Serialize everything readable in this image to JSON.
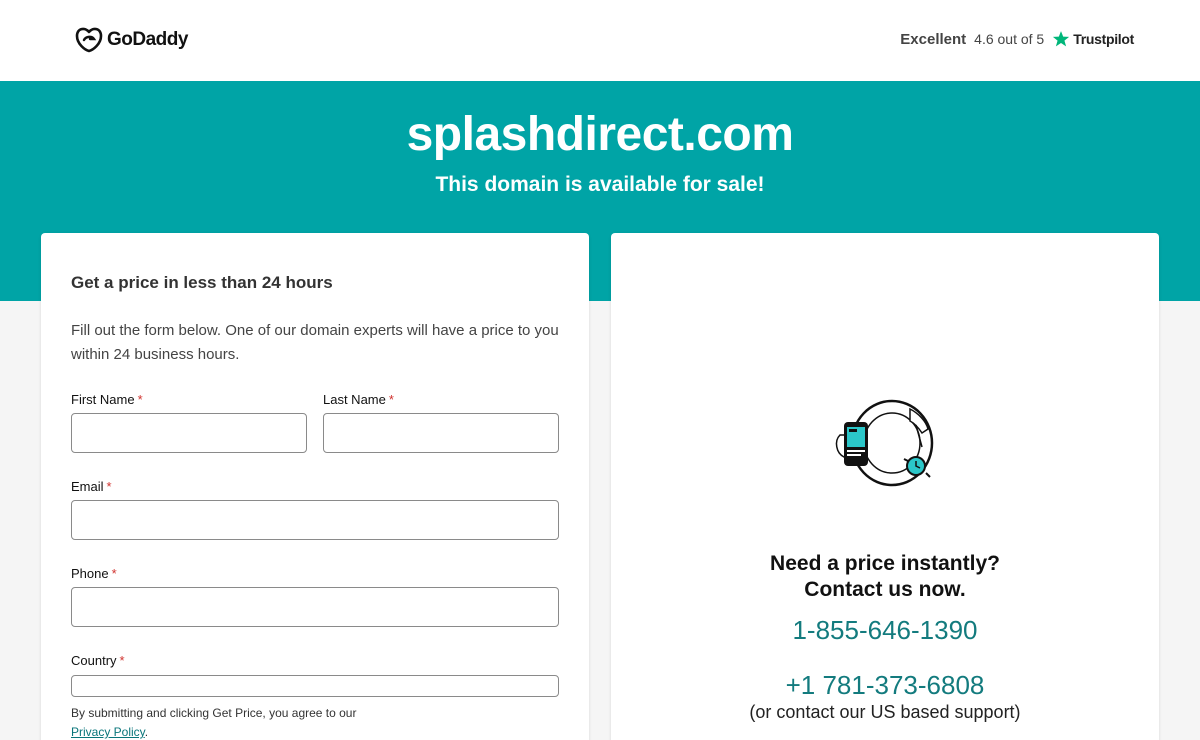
{
  "header": {
    "logo_text": "GoDaddy",
    "rating_word": "Excellent",
    "rating_score": "4.6 out of 5",
    "rating_brand": "Trustpilot"
  },
  "hero": {
    "domain": "splashdirect.com",
    "tagline": "This domain is available for sale!"
  },
  "form": {
    "title": "Get a price in less than 24 hours",
    "description": "Fill out the form below. One of our domain experts will have a price to you within 24 business hours.",
    "required_marker": "*",
    "first_name_label": "First Name",
    "first_name_value": "",
    "last_name_label": "Last Name",
    "last_name_value": "",
    "email_label": "Email",
    "email_value": "",
    "phone_label": "Phone",
    "phone_value": "",
    "country_label": "Country",
    "country_value": "",
    "legal_text": "By submitting and clicking Get Price, you agree to our",
    "privacy_link": "Privacy Policy",
    "legal_end": "."
  },
  "contact": {
    "cta_line1": "Need a price instantly?",
    "cta_line2": "Contact us now.",
    "phone_1": "1-855-646-1390",
    "phone_2": "+1 781-373-6808",
    "support_note": "(or contact our US based support)"
  },
  "colors": {
    "hero_teal": "#00a4a6",
    "phone_teal": "#137b7e",
    "trustpilot_green": "#00b67a",
    "required_red": "#d0312d"
  },
  "icons": {
    "logo": "godaddy-logo",
    "rating": "trustpilot-star-icon",
    "illustration": "phone-hand-illustration"
  }
}
